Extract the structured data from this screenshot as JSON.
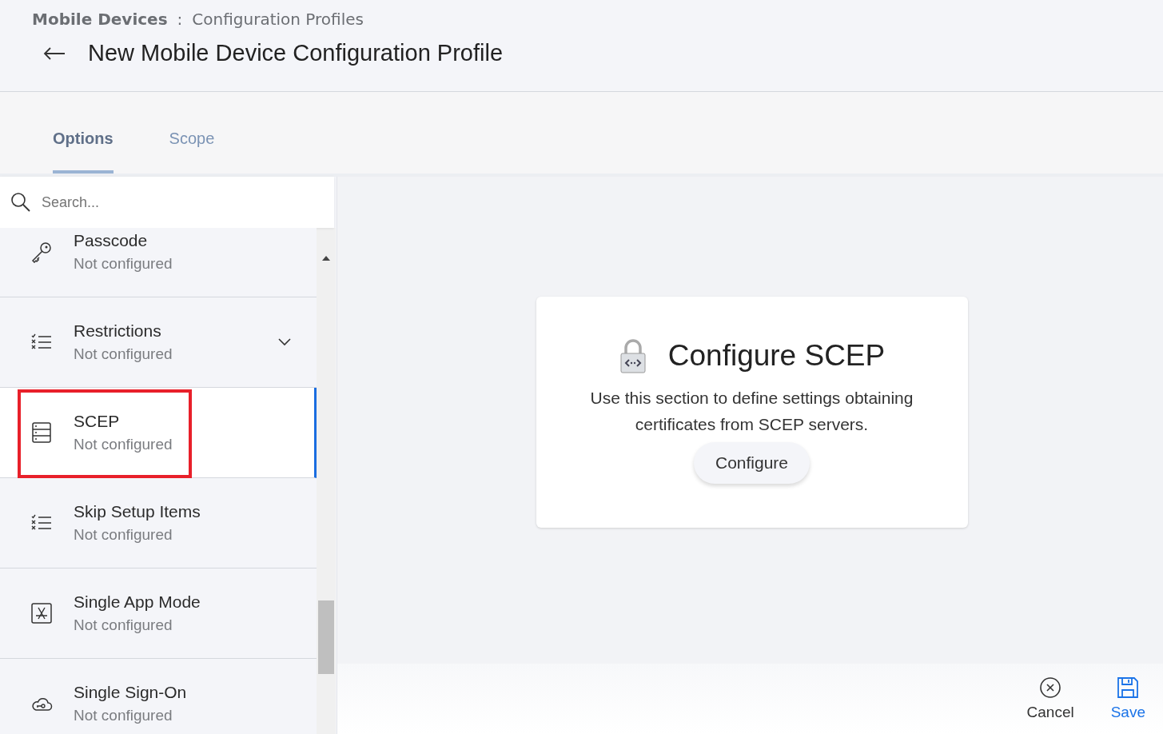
{
  "breadcrumb": {
    "parent": "Mobile Devices",
    "separator": ":",
    "current": "Configuration Profiles"
  },
  "title": "New Mobile Device Configuration Profile",
  "tabs": [
    {
      "label": "Options",
      "selected": true
    },
    {
      "label": "Scope",
      "selected": false
    }
  ],
  "search": {
    "placeholder": "Search..."
  },
  "payloads": [
    {
      "kind": "key",
      "name": "Passcode",
      "status": "Not configured",
      "selected": false,
      "highlighted": false
    },
    {
      "kind": "checklist",
      "name": "Restrictions",
      "status": "Not configured",
      "selected": false,
      "highlighted": false,
      "expanded": false
    },
    {
      "kind": "server",
      "name": "SCEP",
      "status": "Not configured",
      "selected": true,
      "highlighted": true
    },
    {
      "kind": "checklist",
      "name": "Skip Setup Items",
      "status": "Not configured",
      "selected": false,
      "highlighted": false
    },
    {
      "kind": "app",
      "name": "Single App Mode",
      "status": "Not configured",
      "selected": false,
      "highlighted": false
    },
    {
      "kind": "cloud-key",
      "name": "Single Sign-On",
      "status": "Not configured",
      "selected": false,
      "highlighted": false
    }
  ],
  "panel": {
    "title": "Configure SCEP",
    "description": "Use this section to define settings obtaining certificates from SCEP servers.",
    "button": "Configure"
  },
  "footer": {
    "cancel": "Cancel",
    "save": "Save"
  }
}
